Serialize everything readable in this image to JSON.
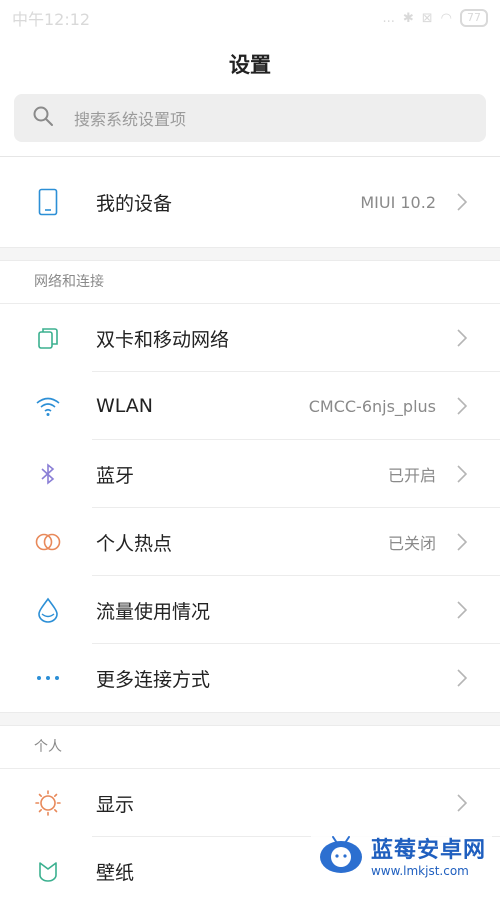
{
  "status_bar": {
    "time": "中午12:12",
    "dots": "...",
    "battery": "77"
  },
  "page_title": "设置",
  "search": {
    "placeholder": "搜索系统设置项"
  },
  "my_device": {
    "label": "我的设备",
    "value": "MIUI 10.2"
  },
  "network_section": {
    "header": "网络和连接",
    "items": [
      {
        "label": "双卡和移动网络",
        "value": "",
        "icon": "dual-sim-icon"
      },
      {
        "label": "WLAN",
        "value": "CMCC-6njs_plus",
        "icon": "wifi-icon"
      },
      {
        "label": "蓝牙",
        "value": "已开启",
        "icon": "bluetooth-icon"
      },
      {
        "label": "个人热点",
        "value": "已关闭",
        "icon": "hotspot-icon"
      },
      {
        "label": "流量使用情况",
        "value": "",
        "icon": "data-usage-icon"
      },
      {
        "label": "更多连接方式",
        "value": "",
        "icon": "more-connections-icon"
      }
    ]
  },
  "personal_section": {
    "header": "个人",
    "items": [
      {
        "label": "显示",
        "value": "",
        "icon": "display-icon"
      },
      {
        "label": "壁纸",
        "value": "",
        "icon": "wallpaper-icon"
      }
    ]
  },
  "watermark": {
    "title": "蓝莓安卓网",
    "url": "www.lmkjst.com"
  },
  "colors": {
    "accent_blue": "#2c8fd6",
    "bluetooth_purple": "#8a7fd6",
    "hotspot_orange": "#e8895a",
    "wallpaper_green": "#3bb08f"
  }
}
